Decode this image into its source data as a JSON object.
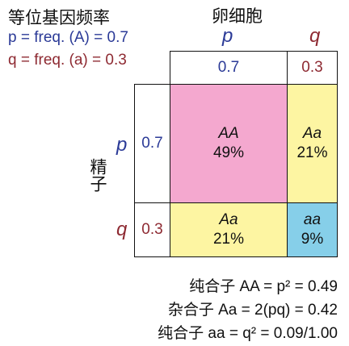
{
  "title": "等位基因频率",
  "legend": {
    "p_line": "p = freq. (A) = 0.7",
    "q_line": "q = freq. (a) = 0.3"
  },
  "eggs": {
    "title": "卵细胞",
    "p_allele": "p",
    "q_allele": "q",
    "p_value": "0.7",
    "q_value": "0.3"
  },
  "sperm": {
    "title": "精子",
    "p_allele": "p",
    "q_allele": "q",
    "p_value": "0.7",
    "q_value": "0.3"
  },
  "cells": {
    "AA": {
      "genotype": "AA",
      "percent": "49%"
    },
    "Aa_top": {
      "genotype": "Aa",
      "percent": "21%"
    },
    "Aa_bottom": {
      "genotype": "Aa",
      "percent": "21%"
    },
    "aa": {
      "genotype": "aa",
      "percent": "9%"
    }
  },
  "equations": {
    "line1": "纯合子 AA = p² = 0.49",
    "line2": "杂合子 Aa = 2(pq) = 0.42",
    "line3": "纯合子 aa = q² = 0.09/1.00"
  },
  "colors": {
    "pink": "#f4a8cf",
    "yellow": "#fdf5a2",
    "blue_cell": "#86cfe9",
    "blue_text": "#2b3a97",
    "red_text": "#8e2a32"
  }
}
